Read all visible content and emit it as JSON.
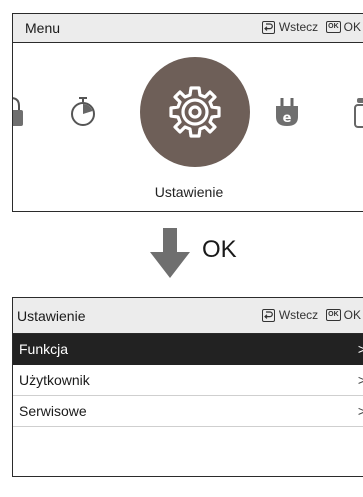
{
  "menu_screen": {
    "title": "Menu",
    "back_label": "Wstecz",
    "ok_badge": "OK",
    "ok_label": "OK",
    "selected_label": "Ustawienie",
    "icons": [
      "lock-icon",
      "timer-icon",
      "gear-icon",
      "energy-plug-icon",
      "partial-icon"
    ]
  },
  "transition": {
    "label": "OK"
  },
  "settings_screen": {
    "title": "Ustawienie",
    "back_label": "Wstecz",
    "ok_badge": "OK",
    "ok_label": "OK",
    "items": [
      {
        "label": "Funkcja",
        "chevron": ">",
        "selected": true
      },
      {
        "label": "Użytkownik",
        "chevron": ">",
        "selected": false
      },
      {
        "label": "Serwisowe",
        "chevron": ">",
        "selected": false
      }
    ]
  },
  "colors": {
    "selected_bg": "#222222",
    "icon_circle": "#6e5f58",
    "header_bg": "#ececec"
  }
}
